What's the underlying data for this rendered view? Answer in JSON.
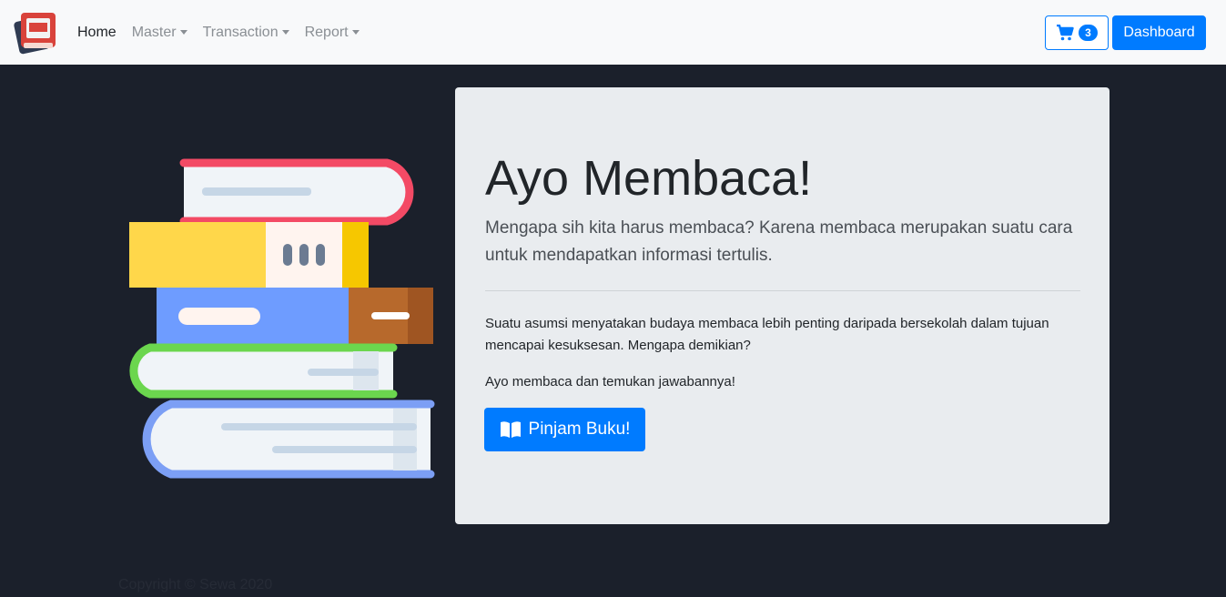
{
  "nav": {
    "brand_icon": "book-logo-icon",
    "items": [
      {
        "label": "Home",
        "dropdown": false,
        "active": true
      },
      {
        "label": "Master",
        "dropdown": true,
        "active": false
      },
      {
        "label": "Transaction",
        "dropdown": true,
        "active": false
      },
      {
        "label": "Report",
        "dropdown": true,
        "active": false
      }
    ],
    "cart": {
      "icon": "cart-icon",
      "count": "3"
    },
    "dashboard_label": "Dashboard"
  },
  "hero": {
    "illustration": "book-stack-illustration",
    "title": "Ayo Membaca!",
    "lead": "Mengapa sih kita harus membaca? Karena membaca merupakan suatu cara untuk mendapatkan informasi tertulis.",
    "paragraph1": "Suatu asumsi menyatakan budaya membaca lebih penting daripada bersekolah dalam tujuan mencapai kesuksesan. Mengapa demikian?",
    "paragraph2": "Ayo membaca dan temukan jawabannya!",
    "button_label": "Pinjam Buku!",
    "button_icon": "open-book-icon"
  },
  "footer": {
    "text": "Copyright © Sewa 2020"
  },
  "colors": {
    "primary": "#007bff",
    "background": "#1b202b",
    "navbar": "#f8f9fa",
    "jumbotron": "#e9ecef"
  }
}
